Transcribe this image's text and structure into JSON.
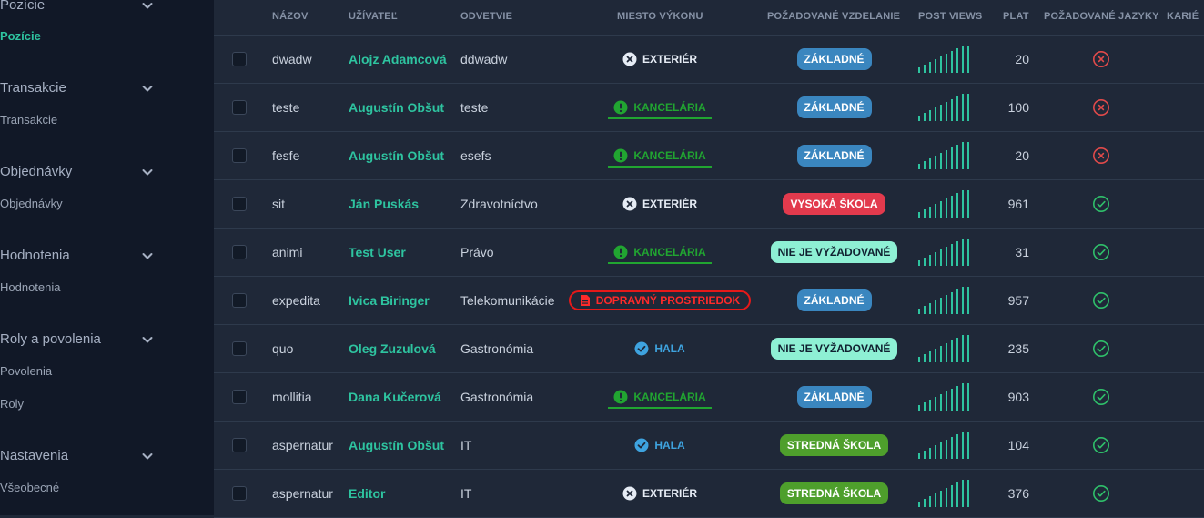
{
  "sidebar": {
    "groups": [
      {
        "label": "Pozície",
        "items": [
          "Pozície"
        ],
        "active_item": 0
      },
      {
        "label": "Transakcie",
        "items": [
          "Transakcie"
        ]
      },
      {
        "label": "Objednávky",
        "items": [
          "Objednávky"
        ]
      },
      {
        "label": "Hodnotenia",
        "items": [
          "Hodnotenia"
        ]
      },
      {
        "label": "Roly a povolenia",
        "items": [
          "Povolenia",
          "Roly"
        ]
      },
      {
        "label": "Nastavenia",
        "items": [
          "Všeobecné"
        ]
      }
    ]
  },
  "table": {
    "headers": {
      "nazov": "NÁZOV",
      "uzivatel": "UŽÍVATEĽ",
      "odvetvie": "ODVETVIE",
      "miesto": "MIESTO VÝKONU",
      "vzdelanie": "POŽADOVANÉ VZDELANIE",
      "post_views": "POST VIEWS",
      "plat": "PLAT",
      "jazyky": "POŽADOVANÉ JAZYKY",
      "kariera": "KARIÉ"
    },
    "rows": [
      {
        "name": "dwadw",
        "user": "Alojz Adamcová",
        "sector": "ddwadw",
        "location": "EXTERIÉR",
        "location_type": "exterier",
        "education": "ZÁKLADNÉ",
        "education_type": "zakladne",
        "salary": "20",
        "languages_ok": false
      },
      {
        "name": "teste",
        "user": "Augustín Obšut",
        "sector": "teste",
        "location": "KANCELÁRIA",
        "location_type": "kancelaria",
        "education": "ZÁKLADNÉ",
        "education_type": "zakladne",
        "salary": "100",
        "languages_ok": false
      },
      {
        "name": "fesfe",
        "user": "Augustín Obšut",
        "sector": "esefs",
        "location": "KANCELÁRIA",
        "location_type": "kancelaria",
        "education": "ZÁKLADNÉ",
        "education_type": "zakladne",
        "salary": "20",
        "languages_ok": false
      },
      {
        "name": "sit",
        "user": "Ján Puskás",
        "sector": "Zdravotníctvo",
        "location": "EXTERIÉR",
        "location_type": "exterier",
        "education": "VYSOKÁ ŠKOLA",
        "education_type": "vysoka",
        "salary": "961",
        "languages_ok": true
      },
      {
        "name": "animi",
        "user": "Test User",
        "sector": "Právo",
        "location": "KANCELÁRIA",
        "location_type": "kancelaria",
        "education": "NIE JE VYŽADOVANÉ",
        "education_type": "nie",
        "salary": "31",
        "languages_ok": true
      },
      {
        "name": "expedita",
        "user": "Ivica Biringer",
        "sector": "Telekomunikácie",
        "location": "DOPRAVNÝ PROSTRIEDOK",
        "location_type": "dopravny",
        "education": "ZÁKLADNÉ",
        "education_type": "zakladne",
        "salary": "957",
        "languages_ok": true
      },
      {
        "name": "quo",
        "user": "Oleg Zuzulová",
        "sector": "Gastronómia",
        "location": "HALA",
        "location_type": "hala",
        "education": "NIE JE VYŽADOVANÉ",
        "education_type": "nie",
        "salary": "235",
        "languages_ok": true
      },
      {
        "name": "mollitia",
        "user": "Dana Kučerová",
        "sector": "Gastronómia",
        "location": "KANCELÁRIA",
        "location_type": "kancelaria",
        "education": "ZÁKLADNÉ",
        "education_type": "zakladne",
        "salary": "903",
        "languages_ok": true
      },
      {
        "name": "aspernatur",
        "user": "Augustín Obšut",
        "sector": "IT",
        "location": "HALA",
        "location_type": "hala",
        "education": "STREDNÁ ŠKOLA",
        "education_type": "stredna",
        "salary": "104",
        "languages_ok": true
      },
      {
        "name": "aspernatur",
        "user": "Editor",
        "sector": "IT",
        "location": "EXTERIÉR",
        "location_type": "exterier",
        "education": "STREDNÁ ŠKOLA",
        "education_type": "stredna",
        "salary": "376",
        "languages_ok": true
      }
    ]
  },
  "colors": {
    "accent": "#2ec4a0",
    "zakladne": "#3a86bf",
    "vysoka": "#e23a4d",
    "nie": "#8ef0d4",
    "stredna": "#4e9f2c",
    "error": "#e04a4a",
    "success": "#2fbf6a",
    "kancelaria": "#21a531",
    "hala": "#3ea3df",
    "dopravny": "#e61919"
  }
}
